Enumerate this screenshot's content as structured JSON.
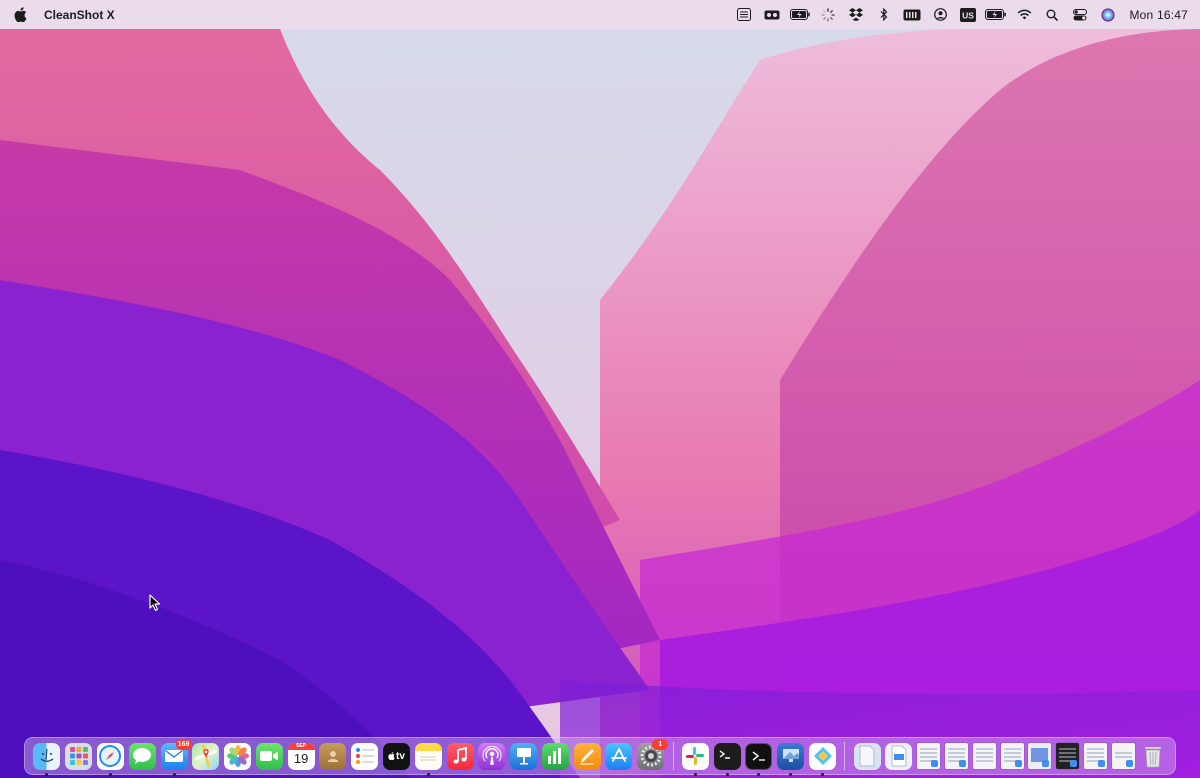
{
  "menubar": {
    "app_name": "CleanShot X",
    "clock": "Mon  16:47",
    "icons": [
      "apple-icon",
      "list-icon",
      "cleanshot-icon",
      "battery-charging-icon",
      "loading-icon",
      "dropbox-icon",
      "bluetooth-icon",
      "memory-icon",
      "user-icon",
      "input-source-icon",
      "battery-icon",
      "wifi-icon",
      "spotlight-icon",
      "control-center-icon",
      "siri-icon"
    ],
    "input_source": "US"
  },
  "calendar": {
    "month": "SEP",
    "day": "19"
  },
  "appletv": {
    "label": "tv"
  },
  "dock": {
    "badges": {
      "mail": "169",
      "settings": "1"
    }
  },
  "colors": {
    "menubar_bg": "#f0dceb",
    "accent": "#3d8ef0",
    "badge": "#ff3b30"
  }
}
